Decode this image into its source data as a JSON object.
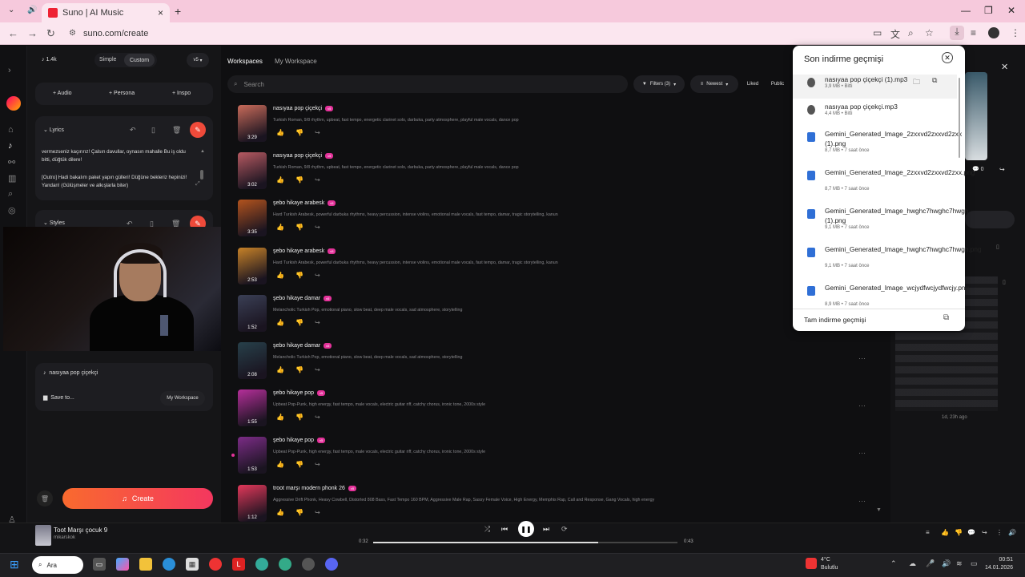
{
  "browser": {
    "tab_title": "Suno | AI Music",
    "url": "suno.com/create"
  },
  "sidebar_top": {
    "credits": "1.4k",
    "mode_simple": "Simple",
    "mode_custom": "Custom",
    "version": "v5"
  },
  "add_buttons": {
    "audio": "+ Audio",
    "persona": "+ Persona",
    "inspo": "+ Inspo"
  },
  "lyrics": {
    "label": "Lyrics",
    "line1": "vermezseniz kaçırırız! Çalsın davullar, oynasın mahalle Bu iş oldu bitti, düğtük dilere!",
    "line2": "[Outro] Hadi bakalım paket yapın gülleri! Düğüne bekleriz hepinizi! Yandan! (Gülüşmeler ve alkışlarla biter)"
  },
  "styles": {
    "label": "Styles"
  },
  "song_title_field": "nasıyaa pop çiçekçi",
  "save_to": {
    "label": "Save to...",
    "value": "My Workspace"
  },
  "create_button": "Create",
  "workspace": {
    "breadcrumb_root": "Workspaces",
    "breadcrumb_current": "My Workspace",
    "search_placeholder": "Search",
    "filters": "Filters (3)",
    "sort": "Newest",
    "liked": "Liked",
    "public": "Public"
  },
  "songs": [
    {
      "title": "nasıyaa pop çiçekçi",
      "version": "v5",
      "duration": "3:29",
      "desc": "Turkish Roman, 9/8 rhythm, upbeat, fast tempo, energetic clarinet solo, darbuka, party atmosphere, playful male vocals, dance pop",
      "color": "#c96b5a"
    },
    {
      "title": "nasıyaa pop çiçekçi",
      "version": "v5",
      "duration": "3:02",
      "desc": "Turkish Roman, 9/8 rhythm, upbeat, fast tempo, energetic clarinet solo, darbuka, party atmosphere, playful male vocals, dance pop",
      "color": "#b75a62"
    },
    {
      "title": "şebo hikaye arabesk",
      "version": "v5",
      "duration": "3:35",
      "desc": "Hard Turkish Arabesk, powerful darbuka rhythms, heavy percussion, intense violins, emotional male vocals, fast tempo, damar, tragic storytelling, kanun",
      "color": "#b3531e"
    },
    {
      "title": "şebo hikaye arabesk",
      "version": "v5",
      "duration": "2:53",
      "desc": "Hard Turkish Arabesk, powerful darbuka rhythms, heavy percussion, intense violins, emotional male vocals, fast tempo, damar, tragic storytelling, kanun",
      "color": "#c78228"
    },
    {
      "title": "şebo hikaye damar",
      "version": "v5",
      "duration": "1:52",
      "desc": "Melancholic Turkish Pop, emotional piano, slow beat, deep male vocals, sad atmosphere, storytelling",
      "color": "#3a3f55"
    },
    {
      "title": "şebo hikaye damar",
      "version": "v5",
      "duration": "2:08",
      "desc": "Melancholic Turkish Pop, emotional piano, slow beat, deep male vocals, sad atmosphere, storytelling",
      "color": "#27404a"
    },
    {
      "title": "şebo hikaye pop",
      "version": "v5",
      "duration": "1:55",
      "desc": "Upbeat Pop-Punk, high energy, fast tempo, male vocals, electric guitar riff, catchy chorus, ironic tone, 2000s style",
      "color": "#b52f9a"
    },
    {
      "title": "şebo hikaye pop",
      "version": "v5",
      "duration": "1:53",
      "desc": "Upbeat Pop-Punk, high energy, fast tempo, male vocals, electric guitar riff, catchy chorus, ironic tone, 2000s style",
      "color": "#7b2c86"
    },
    {
      "title": "troot marşı modern phonk 26",
      "version": "v5",
      "duration": "1:12",
      "desc": "Aggressive Drift Phonk, Heavy Cowbell, Distorted 808 Bass, Fast Tempo 160 BPM, Aggressive Male Rap, Sassy Female Voice, High Energy, Memphis Rap, Call and Response, Gang Vocals, high energy",
      "color": "#e2385a"
    }
  ],
  "downloads": {
    "title": "Son indirme geçmişi",
    "items": [
      {
        "name": "nasıyaa pop çiçekçi (1).mp3",
        "meta": "3,9 MB • Bitti",
        "kind": "audio"
      },
      {
        "name": "nasıyaa pop çiçekçi.mp3",
        "meta": "4,4 MB • Bitti",
        "kind": "audio"
      },
      {
        "name": "Gemini_Generated_Image_2zxxvd2zxxvd2zxx (1).png",
        "meta": "8,7 MB • 7 saat önce",
        "kind": "image"
      },
      {
        "name": "Gemini_Generated_Image_2zxxvd2zxxvd2zxx.png",
        "meta": "8,7 MB • 7 saat önce",
        "kind": "image"
      },
      {
        "name": "Gemini_Generated_Image_hwghc7hwghc7hwgh (1).png",
        "meta": "9,1 MB • 7 saat önce",
        "kind": "image"
      },
      {
        "name": "Gemini_Generated_Image_hwghc7hwghc7hwgh.png",
        "meta": "9,1 MB • 7 saat önce",
        "kind": "image"
      },
      {
        "name": "Gemini_Generated_Image_wcjydfwcjydfwcjy.png",
        "meta": "8,9 MB • 7 saat önce",
        "kind": "image"
      }
    ],
    "footer": "Tam indirme geçmişi"
  },
  "right_panel": {
    "comments_count": "0",
    "time_ago": "1d, 23h ago"
  },
  "player": {
    "title": "Toot Marşı çocuk 9",
    "artist": "mikarskok",
    "elapsed": "0:32",
    "total": "0:43",
    "progress": 0.74
  },
  "taskbar": {
    "search": "Ara",
    "temp": "4°C",
    "weather": "Bulutlu",
    "time": "00:51",
    "date": "14.01.2026"
  }
}
